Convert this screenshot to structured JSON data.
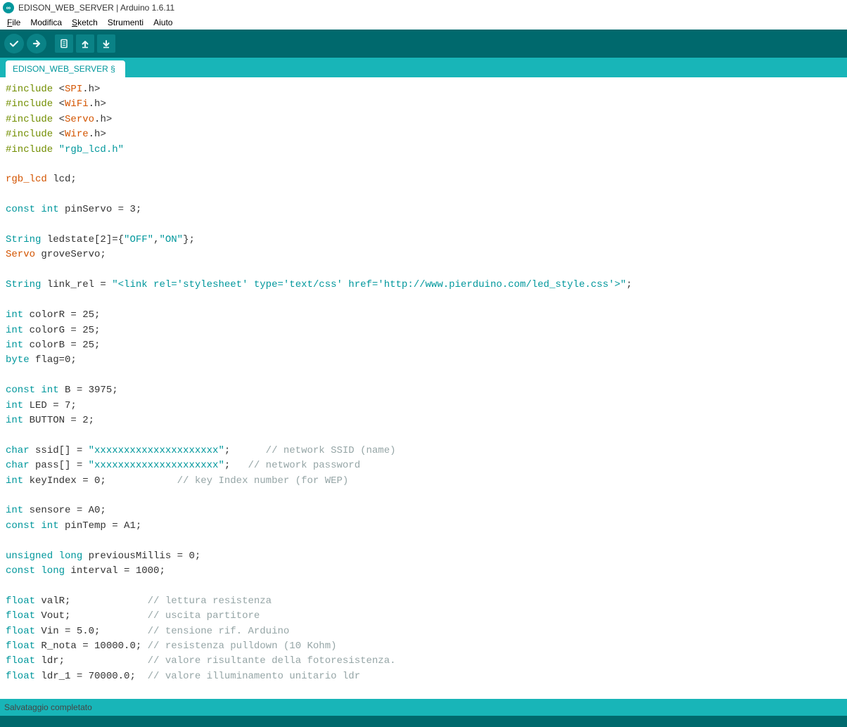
{
  "window": {
    "title": "EDISON_WEB_SERVER | Arduino 1.6.11",
    "logo_text": "∞"
  },
  "menu": {
    "file": "File",
    "edit": "Modifica",
    "sketch": "Sketch",
    "tools": "Strumenti",
    "help": "Aiuto"
  },
  "tabs": {
    "main": "EDISON_WEB_SERVER §"
  },
  "status": {
    "message": "Salvataggio completato"
  },
  "code": {
    "l01_inc": "#include ",
    "l01_lt": "<",
    "l01_lib": "SPI",
    "l01_h": ".h>",
    "l02_inc": "#include ",
    "l02_lt": "<",
    "l02_lib": "WiFi",
    "l02_h": ".h>",
    "l03_inc": "#include ",
    "l03_lt": "<",
    "l03_lib": "Servo",
    "l03_h": ".h>",
    "l04_inc": "#include ",
    "l04_lt": "<",
    "l04_lib": "Wire",
    "l04_h": ".h>",
    "l05_inc": "#include ",
    "l05_str": "\"rgb_lcd.h\"",
    "l07_cls": "rgb_lcd",
    "l07_rest": " lcd;",
    "l09_kw": "const int",
    "l09_rest": " pinServo = 3;",
    "l11_kw": "String",
    "l11_mid": " ledstate[2]={",
    "l11_s1": "\"OFF\"",
    "l11_c": ",",
    "l11_s2": "\"ON\"",
    "l11_end": "};",
    "l12_cls": "Servo",
    "l12_rest": " groveServo;",
    "l14_kw": "String",
    "l14_mid": " link_rel = ",
    "l14_str": "\"<link rel='stylesheet' type='text/css' href='http://www.pierduino.com/led_style.css'>\"",
    "l14_end": ";",
    "l16_kw": "int",
    "l16_rest": " colorR = 25;",
    "l17_kw": "int",
    "l17_rest": " colorG = 25;",
    "l18_kw": "int",
    "l18_rest": " colorB = 25;",
    "l19_kw": "byte",
    "l19_rest": " flag=0;",
    "l21_kw": "const int",
    "l21_rest": " B = 3975;",
    "l22_kw": "int",
    "l22_rest": " LED = 7;",
    "l23_kw": "int",
    "l23_rest": " BUTTON = 2;",
    "l25_kw": "char",
    "l25_mid": " ssid[] = ",
    "l25_str": "\"xxxxxxxxxxxxxxxxxxxxx\"",
    "l25_end": ";      ",
    "l25_cmt": "// network SSID (name)",
    "l26_kw": "char",
    "l26_mid": " pass[] = ",
    "l26_str": "\"xxxxxxxxxxxxxxxxxxxxx\"",
    "l26_end": ";   ",
    "l26_cmt": "// network password",
    "l27_kw": "int",
    "l27_rest": " keyIndex = 0;            ",
    "l27_cmt": "// key Index number (for WEP)",
    "l29_kw": "int",
    "l29_rest": " sensore = A0;",
    "l30_kw": "const int",
    "l30_rest": " pinTemp = A1;",
    "l32_kw": "unsigned long",
    "l32_rest": " previousMillis = 0;",
    "l33_kw": "const long",
    "l33_rest": " interval = 1000;",
    "l35_kw": "float",
    "l35_rest": " valR;             ",
    "l35_cmt": "// lettura resistenza",
    "l36_kw": "float",
    "l36_rest": " Vout;             ",
    "l36_cmt": "// uscita partitore",
    "l37_kw": "float",
    "l37_rest": " Vin = 5.0;        ",
    "l37_cmt": "// tensione rif. Arduino",
    "l38_kw": "float",
    "l38_rest": " R_nota = 10000.0; ",
    "l38_cmt": "// resistenza pulldown (10 Kohm)",
    "l39_kw": "float",
    "l39_rest": " ldr;              ",
    "l39_cmt": "// valore risultante della fotoresistenza.",
    "l40_kw": "float",
    "l40_rest": " ldr_1 = 70000.0;  ",
    "l40_cmt": "// valore illuminamento unitario ldr"
  }
}
